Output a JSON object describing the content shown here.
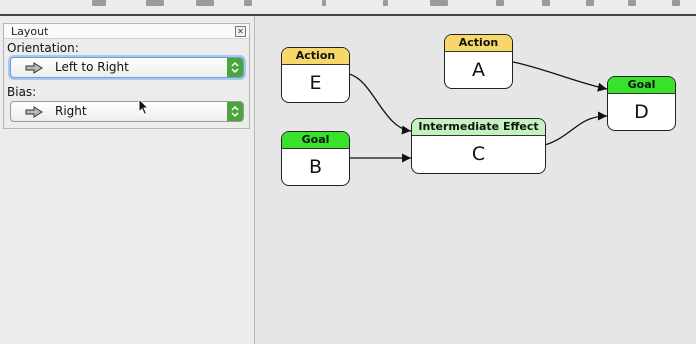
{
  "layout_panel": {
    "title": "Layout",
    "orientation_label": "Orientation:",
    "orientation_value": "Left to Right",
    "bias_label": "Bias:",
    "bias_value": "Right",
    "icons": {
      "close": "close-icon",
      "arrow": "right-arrow-icon",
      "dropdown": "chevron-updown-icon"
    }
  },
  "graph": {
    "colors": {
      "action": "#f7d66a",
      "goal": "#37e22a",
      "intermediate": "#c4f2bf"
    },
    "nodes": {
      "E": {
        "type": "Action",
        "label": "E"
      },
      "A": {
        "type": "Action",
        "label": "A"
      },
      "B": {
        "type": "Goal",
        "label": "B"
      },
      "C": {
        "type": "Intermediate Effect",
        "label": "C"
      },
      "D": {
        "type": "Goal",
        "label": "D"
      }
    },
    "edges": [
      {
        "from": "E",
        "to": "C"
      },
      {
        "from": "B",
        "to": "C"
      },
      {
        "from": "A",
        "to": "D"
      },
      {
        "from": "C",
        "to": "D"
      }
    ]
  }
}
